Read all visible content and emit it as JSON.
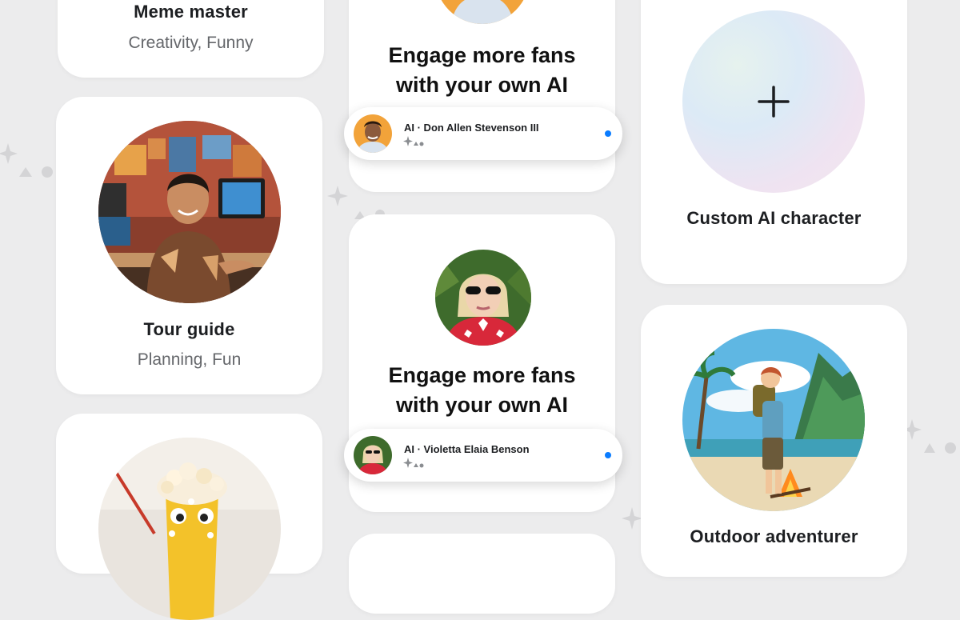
{
  "cards": {
    "meme_master": {
      "title": "Meme master",
      "subtitle": "Creativity, Funny"
    },
    "tour_guide": {
      "title": "Tour guide",
      "subtitle": "Planning, Fun"
    },
    "custom_ai": {
      "title": "Custom AI character",
      "icon": "plus-icon"
    },
    "outdoor": {
      "title": "Outdoor adventurer"
    },
    "promo_top": {
      "headline_line1": "Engage more fans",
      "headline_line2": "with your own AI"
    },
    "promo_mid": {
      "headline_line1": "Engage more fans",
      "headline_line2": "with your own AI"
    }
  },
  "pills": [
    {
      "label": "AI · Don Allen Stevenson III",
      "status_color": "#0a7cff"
    },
    {
      "label": "AI · Violetta Elaia Benson",
      "status_color": "#0a7cff"
    }
  ],
  "colors": {
    "background": "#ececed",
    "card": "#ffffff",
    "accent": "#0a7cff"
  }
}
